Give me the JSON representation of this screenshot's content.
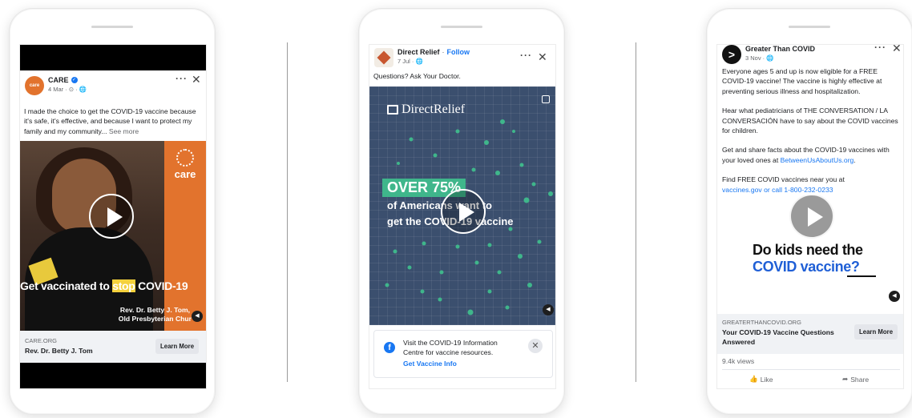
{
  "ad1": {
    "page_name": "CARE",
    "date": "4 Mar · ⊙ · 🌐",
    "text": "I made the choice to get the COVID-19 vaccine because it's safe, it's effective, and because I want to protect my family and my community...",
    "see_more": "See more",
    "caption_part1": "Get vaccinated to ",
    "caption_highlight": "stop",
    "caption_part2": " COVID-19",
    "person_name": "Rev. Dr. Betty J. Tom,",
    "person_org": "Old Presbyterian Chur",
    "logo_text": "care",
    "domain": "CARE.ORG",
    "footer_title": "Rev. Dr. Betty J. Tom",
    "cta": "Learn More"
  },
  "ad2": {
    "page_name": "Direct Relief",
    "follow": "Follow",
    "date": "7 Jul · 🌐",
    "text": "Questions? Ask Your Doctor.",
    "brand": "DirectRelief",
    "stat_box": "OVER 75%",
    "stat_line1": "of Americans want to",
    "stat_line2": "get the COVID-19 vaccine",
    "info_text": "Visit the COVID-19 Information Centre for vaccine resources.",
    "info_link": "Get Vaccine Info"
  },
  "ad3": {
    "page_name": "Greater Than COVID",
    "date": "3 Nov · 🌐",
    "para1": "Everyone ages 5 and up is now eligible for a FREE COVID-19 vaccine! The vaccine is highly effective at preventing serious illness and hospitalization.",
    "para2": "Hear what pediatricians of THE CONVERSATION / LA CONVERSACIÓN have to say about the COVID vaccines for children.",
    "para3_pre": "Get and share facts about the COVID-19 vaccines with your loved ones at ",
    "para3_link": "BetweenUsAboutUs.org",
    "para3_post": ".",
    "para4": "Find FREE COVID vaccines near you at",
    "para5": "vaccines.gov or call 1-800-232-0233",
    "headline1": "Do kids need the",
    "headline2": "COVID vaccine?",
    "domain": "GREATERTHANCOVID.ORG",
    "footer_title": "Your COVID-19 Vaccine Questions Answered",
    "cta": "Learn More",
    "views": "9.4k views",
    "like": "Like",
    "share": "Share"
  },
  "colors": {
    "facebook_blue": "#1877f2",
    "care_orange": "#e2732d",
    "dr_navy": "#3b4f6e",
    "dr_green": "#3fb68b",
    "gtc_blue": "#1f5fd6"
  }
}
